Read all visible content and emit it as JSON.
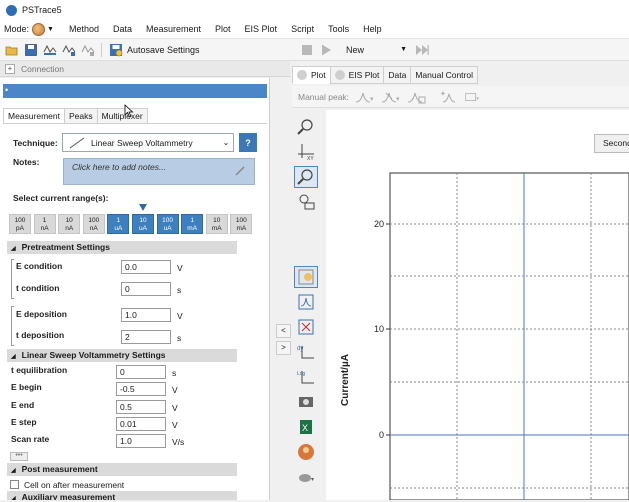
{
  "window": {
    "title": "PSTrace5"
  },
  "menu": {
    "mode_label": "Mode:",
    "items": [
      "Method",
      "Data",
      "Measurement",
      "Plot",
      "EIS Plot",
      "Script",
      "Tools",
      "Help"
    ]
  },
  "toolbar": {
    "autosave_label": "Autosave Settings",
    "new_label": "New"
  },
  "connection": {
    "label": "Connection"
  },
  "method_tabs": [
    "Measurement",
    "Peaks",
    "Multiplexer"
  ],
  "technique": {
    "label": "Technique:",
    "value": "Linear Sweep Voltammetry",
    "help": "?"
  },
  "notes": {
    "label": "Notes:",
    "placeholder": "Click here to add notes..."
  },
  "ranges": {
    "label": "Select current range(s):",
    "buttons": [
      {
        "v": "100",
        "u": "pA",
        "on": false
      },
      {
        "v": "1",
        "u": "nA",
        "on": false
      },
      {
        "v": "10",
        "u": "nA",
        "on": false
      },
      {
        "v": "100",
        "u": "nA",
        "on": false
      },
      {
        "v": "1",
        "u": "uA",
        "on": true
      },
      {
        "v": "10",
        "u": "uA",
        "on": true
      },
      {
        "v": "100",
        "u": "uA",
        "on": true
      },
      {
        "v": "1",
        "u": "mA",
        "on": true
      },
      {
        "v": "10",
        "u": "mA",
        "on": false
      },
      {
        "v": "100",
        "u": "mA",
        "on": false
      }
    ]
  },
  "pretreatment": {
    "title": "Pretreatment Settings",
    "e_condition_label": "E condition",
    "e_condition": "0.0",
    "e_condition_unit": "V",
    "t_condition_label": "t condition",
    "t_condition": "0",
    "t_condition_unit": "s",
    "e_deposition_label": "E deposition",
    "e_deposition": "1.0",
    "e_deposition_unit": "V",
    "t_deposition_label": "t deposition",
    "t_deposition": "2",
    "t_deposition_unit": "s"
  },
  "lsv": {
    "title": "Linear Sweep Voltammetry Settings",
    "t_equilibration_label": "t equilibration",
    "t_equilibration": "0",
    "t_equilibration_unit": "s",
    "e_begin_label": "E begin",
    "e_begin": "-0.5",
    "e_begin_unit": "V",
    "e_end_label": "E end",
    "e_end": "0.5",
    "e_end_unit": "V",
    "e_step_label": "E step",
    "e_step": "0.01",
    "e_step_unit": "V",
    "scan_rate_label": "Scan rate",
    "scan_rate": "1.0",
    "scan_rate_unit": "V/s",
    "more": "•••"
  },
  "post": {
    "title": "Post measurement",
    "cell_on_label": "Cell on after measurement",
    "auxiliary_title": "Auxiliary measurement"
  },
  "plot_tabs": [
    "Plot",
    "EIS Plot",
    "Data",
    "Manual Control"
  ],
  "plot_toolbar": {
    "manual_peak_label": "Manual peak:"
  },
  "plot": {
    "second_button": "Second",
    "ylabel": "Current/µA",
    "ticks": [
      "20",
      "10",
      "0"
    ]
  },
  "colors": {
    "accent": "#4a86c8",
    "range_on": "#3d7fbf"
  }
}
